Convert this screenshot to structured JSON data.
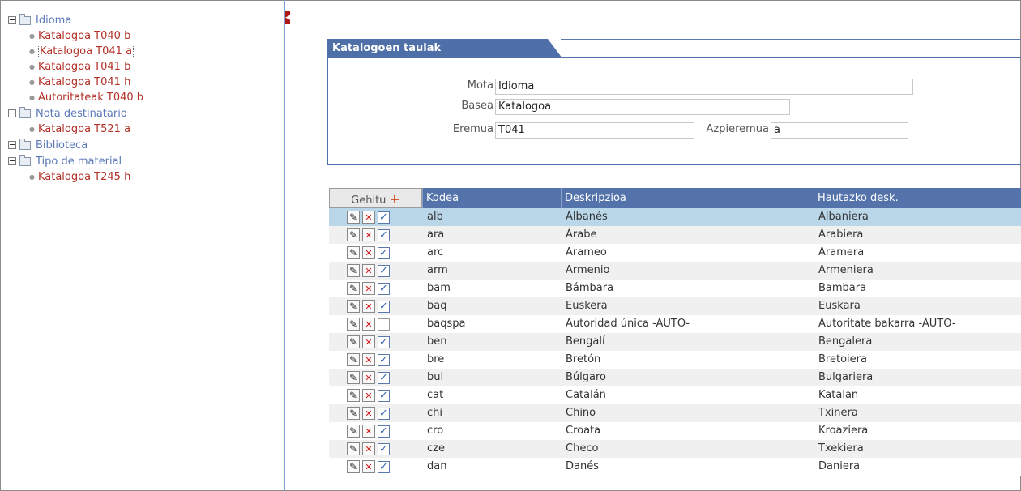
{
  "tree": {
    "groups": [
      {
        "label": "Idioma",
        "items": [
          "Katalogoa T040 b",
          "Katalogoa T041 a",
          "Katalogoa T041 b",
          "Katalogoa T041 h",
          "Autoritateak T040 b"
        ]
      },
      {
        "label": "Nota destinatario",
        "items": [
          "Katalogoa T521 a"
        ]
      },
      {
        "label": "Biblioteca",
        "items": []
      },
      {
        "label": "Tipo de material",
        "items": [
          "Katalogoa T245 h"
        ]
      }
    ],
    "selected": "Katalogoa T041 a"
  },
  "panel": {
    "title": "Katalogoen taulak",
    "fields": {
      "mota": {
        "label": "Mota",
        "value": "Idioma"
      },
      "basea": {
        "label": "Basea",
        "value": "Katalogoa"
      },
      "eremua": {
        "label": "Eremua",
        "value": "T041"
      },
      "azpieremua": {
        "label": "Azpieremua",
        "value": "a"
      }
    }
  },
  "grid": {
    "add_label": "Gehitu",
    "add_symbol": "+",
    "columns": [
      "Kodea",
      "Deskripzioa",
      "Hautazko desk."
    ],
    "rows": [
      {
        "kodea": "alb",
        "desk": "Albanés",
        "haut": "Albaniera",
        "checked": true
      },
      {
        "kodea": "ara",
        "desk": "Árabe",
        "haut": "Arabiera",
        "checked": true
      },
      {
        "kodea": "arc",
        "desk": "Arameo",
        "haut": "Aramera",
        "checked": true
      },
      {
        "kodea": "arm",
        "desk": "Armenio",
        "haut": "Armeniera",
        "checked": true
      },
      {
        "kodea": "bam",
        "desk": "Bámbara",
        "haut": "Bambara",
        "checked": true
      },
      {
        "kodea": "baq",
        "desk": "Euskera",
        "haut": "Euskara",
        "checked": true
      },
      {
        "kodea": "baqspa",
        "desk": "Autoridad única -AUTO-",
        "haut": "Autoritate bakarra -AUTO-",
        "checked": false
      },
      {
        "kodea": "ben",
        "desk": "Bengalí",
        "haut": "Bengalera",
        "checked": true
      },
      {
        "kodea": "bre",
        "desk": "Bretón",
        "haut": "Bretoiera",
        "checked": true
      },
      {
        "kodea": "bul",
        "desk": "Búlgaro",
        "haut": "Bulgariera",
        "checked": true
      },
      {
        "kodea": "cat",
        "desk": "Catalán",
        "haut": "Katalan",
        "checked": true
      },
      {
        "kodea": "chi",
        "desk": "Chino",
        "haut": "Txinera",
        "checked": true
      },
      {
        "kodea": "cro",
        "desk": "Croata",
        "haut": "Kroaziera",
        "checked": true
      },
      {
        "kodea": "cze",
        "desk": "Checo",
        "haut": "Txekiera",
        "checked": true
      },
      {
        "kodea": "dan",
        "desk": "Danés",
        "haut": "Daniera",
        "checked": true
      }
    ],
    "selected_index": 0,
    "icons": {
      "edit": "pencil-icon",
      "delete": "delete-x-icon",
      "check": "checkmark-icon"
    }
  },
  "colors": {
    "accent": "#4e6fa8",
    "link": "#b23027",
    "tree_group": "#5a78b8",
    "row_selected": "#b9d7e8"
  }
}
